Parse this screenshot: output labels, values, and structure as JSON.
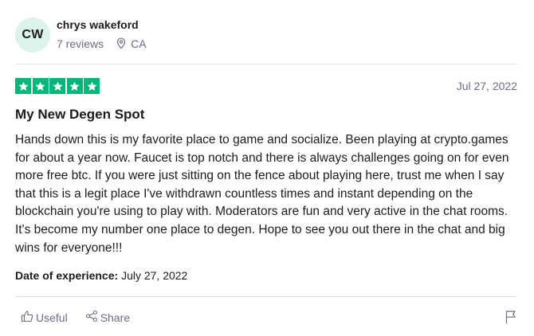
{
  "reviewer": {
    "initials": "CW",
    "name": "chrys wakeford",
    "reviews": "7 reviews",
    "location": "CA"
  },
  "review": {
    "rating": 5,
    "max_rating": 5,
    "date": "Jul 27, 2022",
    "title": "My New Degen Spot",
    "body": "Hands down this is my favorite place to game and socialize. Been playing at crypto.games for about a year now. Faucet is top notch and there is always challenges going on for even more free btc. If you were just sitting on the fence about playing here, trust me when I say that this is a legit place I've withdrawn countless times and instant depending on the blockchain you're using to play with. Moderators are fun and very active in the chat rooms. It's become my number one place to degen. Hope to see you out there in the chat and big wins for everyone!!!",
    "experience_label": "Date of experience:",
    "experience_date": "July 27, 2022"
  },
  "actions": {
    "useful_label": "Useful",
    "share_label": "Share"
  },
  "colors": {
    "star_green": "#00b67a",
    "avatar_bg": "#dcf3ec",
    "muted_text": "#6c6c85"
  },
  "icons": [
    "location-pin-icon",
    "star-icon",
    "thumbs-up-icon",
    "share-icon",
    "flag-icon"
  ]
}
